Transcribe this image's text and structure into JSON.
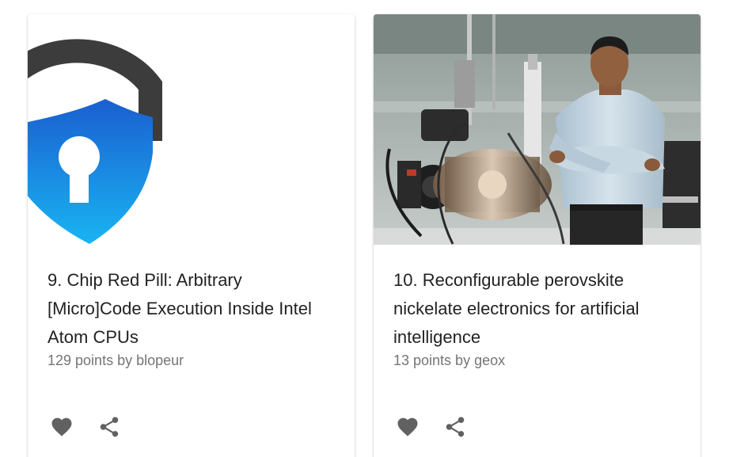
{
  "cards": [
    {
      "title": "9. Chip Red Pill: Arbitrary [Micro]Code Execution Inside Intel Atom CPUs",
      "meta": "129 points by blopeur",
      "image": "lock-shield-illustration",
      "actions": {
        "like_icon": "heart-icon",
        "share_icon": "share-icon"
      }
    },
    {
      "title": "10. Reconfigurable perovskite nickelate electronics for artificial intelligence",
      "meta": "13 points by geox",
      "image": "researcher-with-lab-equipment-photo",
      "actions": {
        "like_icon": "heart-icon",
        "share_icon": "share-icon"
      }
    }
  ],
  "colors": {
    "icon": "#616161",
    "title_text": "#222222",
    "meta_text": "#757575",
    "shield_top": "#1a73d8",
    "shield_bottom": "#1ab0f0",
    "lock_shackle": "#3c3c3c"
  }
}
